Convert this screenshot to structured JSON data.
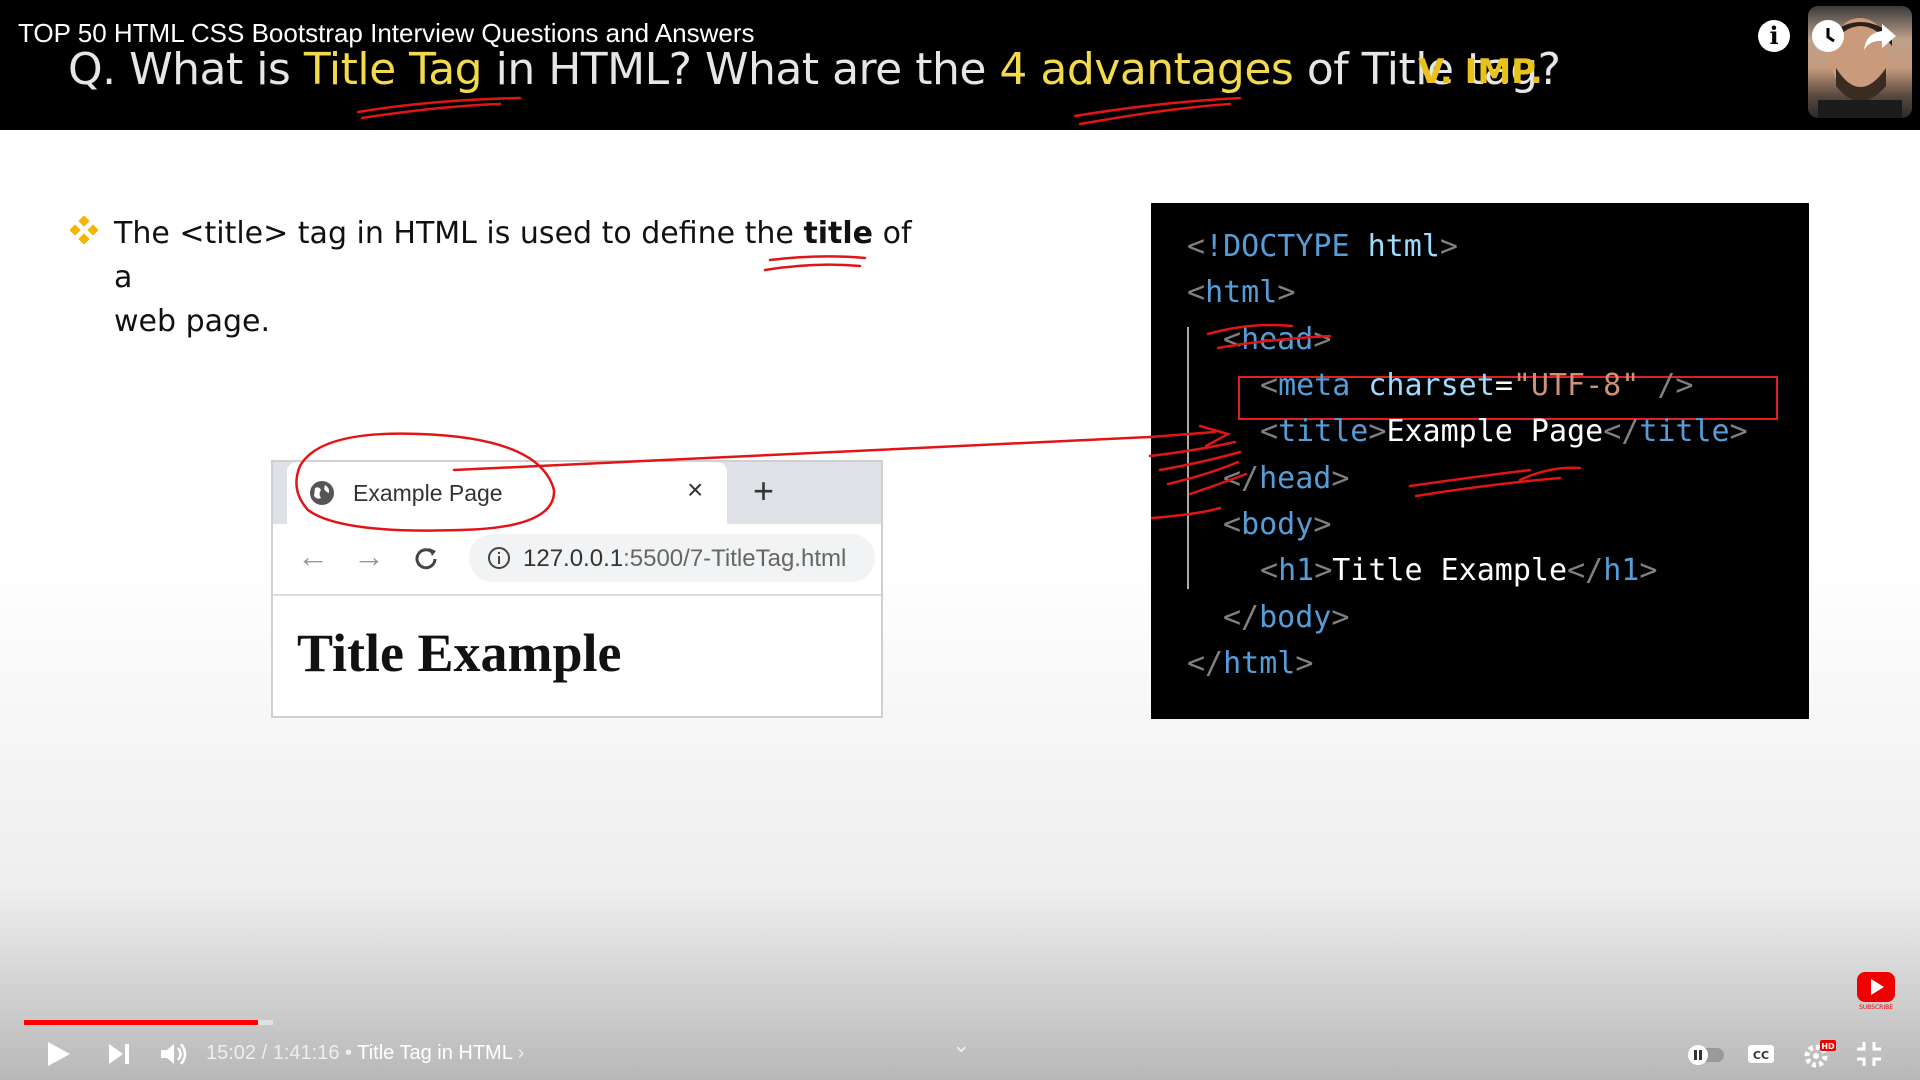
{
  "header": {
    "video_title": "TOP 50 HTML CSS Bootstrap Interview Questions and Answers",
    "question": {
      "p1": "Q. What is ",
      "h1": "Title Tag",
      "p2": " in HTML? What are the ",
      "h2": "4 advantages",
      "p3": " of Title tag?"
    },
    "importance": "V. IMP.",
    "icons": [
      "info-icon",
      "clock-icon",
      "share-icon"
    ]
  },
  "slide": {
    "bullet": {
      "before": "The <title> tag in HTML is used to define the ",
      "bold": "title",
      "after": " of a",
      "line2": "web page."
    },
    "browser": {
      "tab_title": "Example Page",
      "tab_close": "×",
      "new_tab": "+",
      "url_host": "127.0.0.1",
      "url_rest": ":5500/7-TitleTag.html",
      "page_heading": "Title Example"
    },
    "code": {
      "doctype_kw": "!DOCTYPE",
      "doctype_val": "html",
      "html_tag": "html",
      "head_tag": "head",
      "meta_tag": "meta",
      "meta_attr": "charset",
      "meta_val": "\"UTF-8\"",
      "title_tag": "title",
      "title_text": "Example Page",
      "body_tag": "body",
      "h1_tag": "h1",
      "h1_text": "Title Example"
    }
  },
  "player": {
    "current_time": "15:02",
    "duration": "1:41:16",
    "chapter": "Title Tag in HTML",
    "progress_fraction": 0.125,
    "buffered_fraction": 0.133,
    "accent_color": "#ff0000"
  }
}
